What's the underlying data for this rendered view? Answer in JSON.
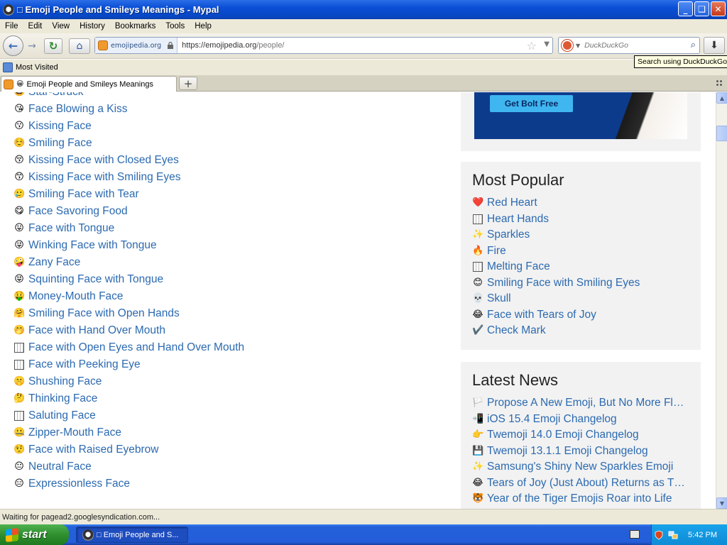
{
  "window": {
    "title": "□ Emoji People and Smileys Meanings - Mypal",
    "minimize": "_",
    "restore": "❏",
    "close": "✕"
  },
  "menu": [
    "File",
    "Edit",
    "View",
    "History",
    "Bookmarks",
    "Tools",
    "Help"
  ],
  "nav": {
    "back_icon": "←",
    "forward_icon": "→",
    "reload_icon": "↻",
    "home_icon": "⌂",
    "site_domain": "emojipedia.org",
    "url_host": "https://emojipedia.org",
    "url_path": "/people/",
    "star_icon": "☆",
    "dropdown_icon": "▼",
    "search_placeholder": "DuckDuckGo",
    "search_icon": "⌕",
    "download_icon": "⬇",
    "search_tooltip": "Search using DuckDuckGo"
  },
  "bookmarks": {
    "most_visited": "Most Visited"
  },
  "tabs": [
    {
      "emoji": "😀",
      "label": "Emoji People and Smileys Meanings"
    }
  ],
  "newtab_label": "+",
  "emoji_list": [
    {
      "glyph": "🤩",
      "name": "Star-Struck"
    },
    {
      "glyph": "😘",
      "name": "Face Blowing a Kiss"
    },
    {
      "glyph": "😗",
      "name": "Kissing Face"
    },
    {
      "glyph": "☺️",
      "name": "Smiling Face"
    },
    {
      "glyph": "😚",
      "name": "Kissing Face with Closed Eyes"
    },
    {
      "glyph": "😙",
      "name": "Kissing Face with Smiling Eyes"
    },
    {
      "glyph": "🥲",
      "name": "Smiling Face with Tear"
    },
    {
      "glyph": "😋",
      "name": "Face Savoring Food"
    },
    {
      "glyph": "😛",
      "name": "Face with Tongue"
    },
    {
      "glyph": "😜",
      "name": "Winking Face with Tongue"
    },
    {
      "glyph": "🤪",
      "name": "Zany Face"
    },
    {
      "glyph": "😝",
      "name": "Squinting Face with Tongue"
    },
    {
      "glyph": "🤑",
      "name": "Money-Mouth Face"
    },
    {
      "glyph": "🤗",
      "name": "Smiling Face with Open Hands"
    },
    {
      "glyph": "🤭",
      "name": "Face with Hand Over Mouth"
    },
    {
      "glyph": "missing",
      "name": "Face with Open Eyes and Hand Over Mouth"
    },
    {
      "glyph": "missing",
      "name": "Face with Peeking Eye"
    },
    {
      "glyph": "🤫",
      "name": "Shushing Face"
    },
    {
      "glyph": "🤔",
      "name": "Thinking Face"
    },
    {
      "glyph": "missing",
      "name": "Saluting Face"
    },
    {
      "glyph": "🤐",
      "name": "Zipper-Mouth Face"
    },
    {
      "glyph": "🤨",
      "name": "Face with Raised Eyebrow"
    },
    {
      "glyph": "😐",
      "name": "Neutral Face"
    },
    {
      "glyph": "😑",
      "name": "Expressionless Face"
    }
  ],
  "ad": {
    "button_label": "Get Bolt Free"
  },
  "most_popular": {
    "title": "Most Popular",
    "items": [
      {
        "glyph": "❤️",
        "name": "Red Heart"
      },
      {
        "glyph": "missing",
        "name": "Heart Hands"
      },
      {
        "glyph": "✨",
        "name": "Sparkles"
      },
      {
        "glyph": "🔥",
        "name": "Fire"
      },
      {
        "glyph": "missing",
        "name": "Melting Face"
      },
      {
        "glyph": "😊",
        "name": "Smiling Face with Smiling Eyes"
      },
      {
        "glyph": "💀",
        "name": "Skull"
      },
      {
        "glyph": "😂",
        "name": "Face with Tears of Joy"
      },
      {
        "glyph": "✔️",
        "name": "Check Mark"
      }
    ]
  },
  "latest_news": {
    "title": "Latest News",
    "items": [
      {
        "glyph": "🏳️",
        "name": "Propose A New Emoji, But No More Fl…"
      },
      {
        "glyph": "📲",
        "name": "iOS 15.4 Emoji Changelog"
      },
      {
        "glyph": "👉",
        "name": "Twemoji 14.0 Emoji Changelog"
      },
      {
        "glyph": "💾",
        "name": "Twemoji 13.1.1 Emoji Changelog"
      },
      {
        "glyph": "✨",
        "name": "Samsung's Shiny New Sparkles Emoji"
      },
      {
        "glyph": "😂",
        "name": "Tears of Joy (Just About) Returns as T…"
      },
      {
        "glyph": "🐯",
        "name": "Year of the Tiger Emojis Roar into Life"
      }
    ]
  },
  "status": {
    "text": "Waiting for pagead2.googlesyndication.com..."
  },
  "taskbar": {
    "start_label": "start",
    "task_label": "□ Emoji People and S...",
    "clock": "5:42 PM"
  }
}
